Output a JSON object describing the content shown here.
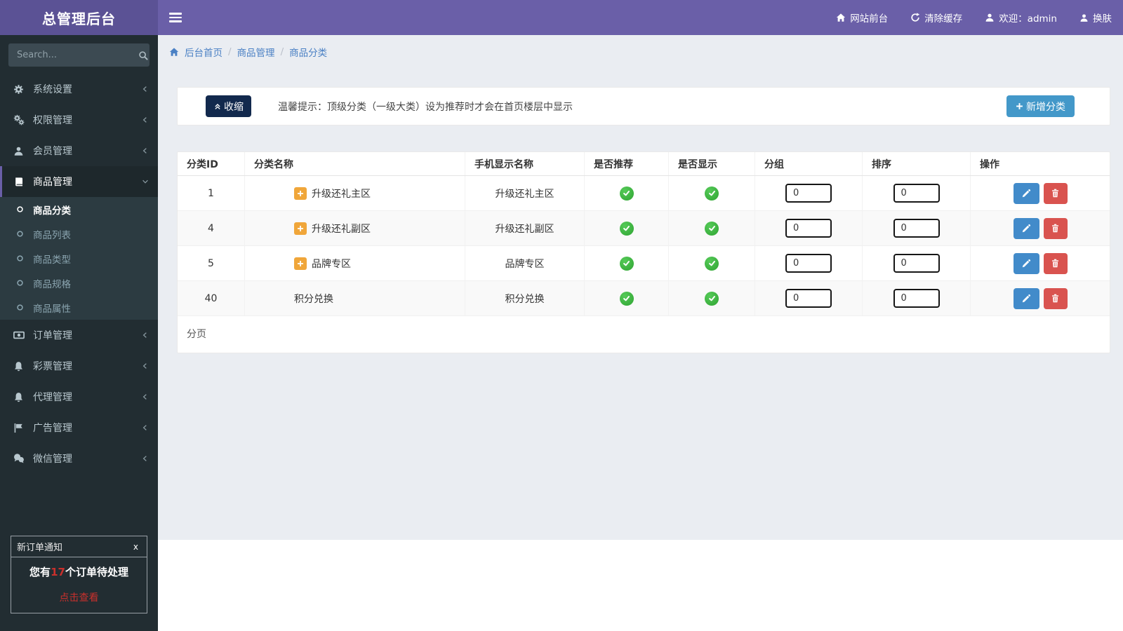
{
  "header": {
    "brand": "总管理后台",
    "nav": [
      {
        "label": "网站前台",
        "icon": "home-icon"
      },
      {
        "label": "清除缓存",
        "icon": "refresh-icon"
      },
      {
        "label": "欢迎：admin",
        "icon": "user-icon"
      },
      {
        "label": "换肤",
        "icon": "skin-icon"
      }
    ]
  },
  "sidebar": {
    "search_placeholder": "Search...",
    "items": [
      {
        "label": "系统设置",
        "icon": "gear-icon"
      },
      {
        "label": "权限管理",
        "icon": "gears-icon"
      },
      {
        "label": "会员管理",
        "icon": "user-icon"
      },
      {
        "label": "商品管理",
        "icon": "book-icon",
        "active": true,
        "children": [
          {
            "label": "商品分类",
            "active": true
          },
          {
            "label": "商品列表"
          },
          {
            "label": "商品类型"
          },
          {
            "label": "商品规格"
          },
          {
            "label": "商品属性"
          }
        ]
      },
      {
        "label": "订单管理",
        "icon": "money-icon"
      },
      {
        "label": "彩票管理",
        "icon": "bell-icon"
      },
      {
        "label": "代理管理",
        "icon": "bell-icon"
      },
      {
        "label": "广告管理",
        "icon": "flag-icon"
      },
      {
        "label": "微信管理",
        "icon": "wechat-icon"
      }
    ]
  },
  "breadcrumb": {
    "items": [
      "后台首页",
      "商品管理",
      "商品分类"
    ],
    "separator": "/"
  },
  "toolbar": {
    "collapse_label": "收缩",
    "hint": "温馨提示：顶级分类（一级大类）设为推荐时才会在首页楼层中显示",
    "add_label": "新增分类"
  },
  "table": {
    "columns": [
      "分类ID",
      "分类名称",
      "手机显示名称",
      "是否推荐",
      "是否显示",
      "分组",
      "排序",
      "操作"
    ],
    "rows": [
      {
        "id": "1",
        "name": "升级还礼主区",
        "has_children": true,
        "mobile_name": "升级还礼主区",
        "recommended": true,
        "visible": true,
        "group": "0",
        "sort": "0"
      },
      {
        "id": "4",
        "name": "升级还礼副区",
        "has_children": true,
        "mobile_name": "升级还礼副区",
        "recommended": true,
        "visible": true,
        "group": "0",
        "sort": "0"
      },
      {
        "id": "5",
        "name": "品牌专区",
        "has_children": true,
        "mobile_name": "品牌专区",
        "recommended": true,
        "visible": true,
        "group": "0",
        "sort": "0"
      },
      {
        "id": "40",
        "name": "积分兑换",
        "has_children": false,
        "mobile_name": "积分兑换",
        "recommended": true,
        "visible": true,
        "group": "0",
        "sort": "0"
      }
    ]
  },
  "pagination_label": "分页",
  "notification": {
    "title": "新订单通知",
    "close_label": "x",
    "message_prefix": "您有",
    "count": "17",
    "message_suffix": "个订单待处理",
    "link_label": "点击查看"
  },
  "colors": {
    "accent_purple": "#6a5fa8",
    "sidebar_bg": "#222d32",
    "success_green": "#3bb240",
    "warning_orange": "#f0a63a",
    "primary_blue": "#428bca",
    "danger_red": "#d9534f"
  }
}
